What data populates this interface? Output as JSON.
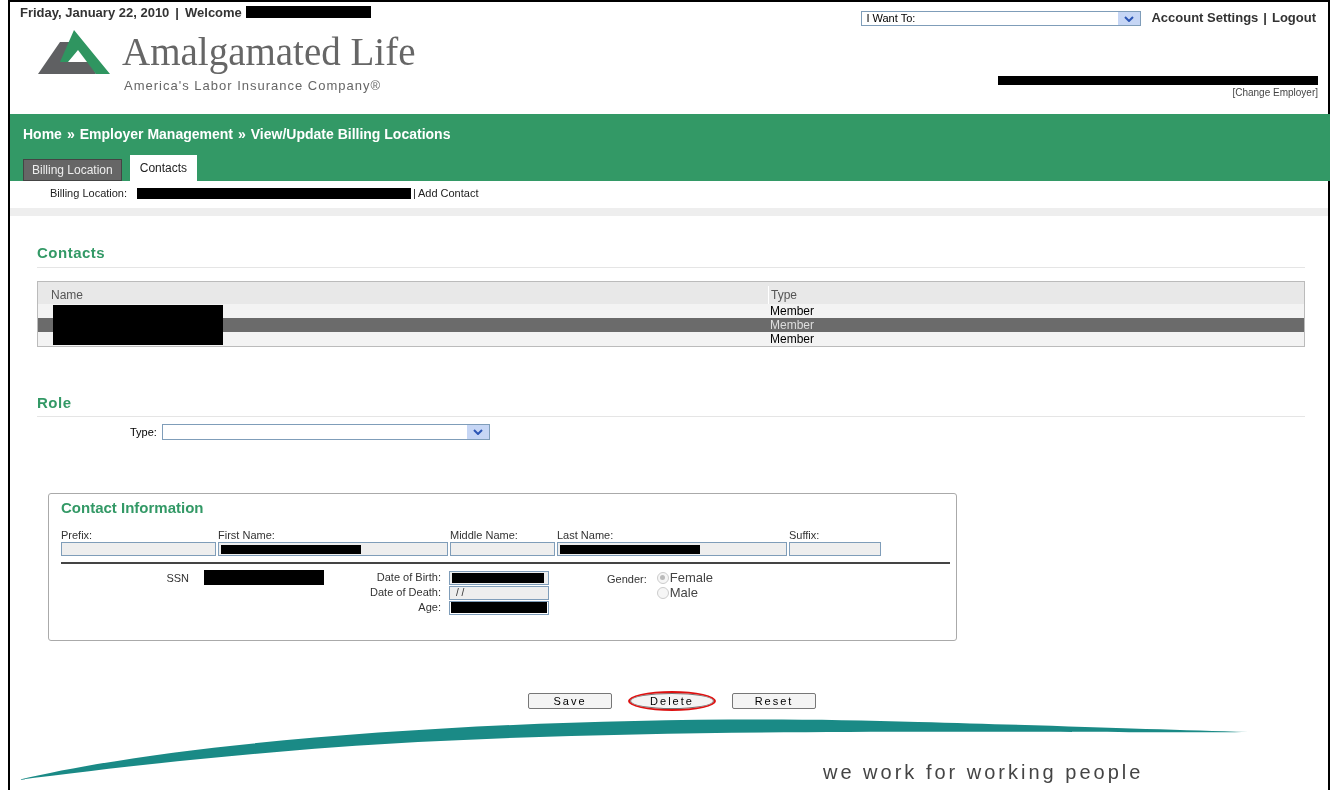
{
  "top_bar": {
    "date": "Friday, January 22, 2010",
    "separator": "|",
    "welcome": "Welcome",
    "links_separator": "|",
    "want_to": {
      "placeholder": "I Want To:"
    },
    "links": [
      "Account Settings",
      "Logout"
    ]
  },
  "logo": {
    "name": "Amalgamated Life",
    "tagline": "America's Labor Insurance Company®"
  },
  "change_employer": "[Change Employer]",
  "breadcrumb": [
    "Home",
    "Employer Management",
    "View/Update Billing Locations"
  ],
  "breadcrumb_separators": [
    "»",
    "»"
  ],
  "tabs": [
    {
      "label": "Billing Location",
      "selected": false
    },
    {
      "label": "Contacts",
      "selected": true
    }
  ],
  "billing_location": {
    "label": "Billing Location:",
    "separator": "|",
    "link": "Add Contact"
  },
  "contacts": {
    "heading": "Contacts",
    "columns": [
      "Name",
      "Type"
    ],
    "rows": [
      {
        "type": "Member",
        "selected": false
      },
      {
        "type": "Member",
        "selected": true
      },
      {
        "type": "Member",
        "selected": false
      }
    ]
  },
  "role": {
    "heading": "Role",
    "type_label": "Type:"
  },
  "contact_information": {
    "heading": "Contact Information",
    "name_fields": [
      {
        "label": "Prefix:",
        "redacted": false
      },
      {
        "label": "First Name:",
        "redacted": true
      },
      {
        "label": "Middle Name:",
        "redacted": false
      },
      {
        "label": "Last Name:",
        "redacted": true
      },
      {
        "label": "Suffix:",
        "redacted": false
      }
    ],
    "ssn_label": "SSN",
    "dob_label": "Date of Birth:",
    "dod_label": "Date of Death:",
    "dod_value": "/ /",
    "age_label": "Age:",
    "gender_label": "Gender:",
    "gender_options": [
      {
        "label": "Female",
        "selected": true
      },
      {
        "label": "Male",
        "selected": false
      }
    ]
  },
  "buttons": [
    {
      "label": "Save",
      "highlighted": false
    },
    {
      "label": "Delete",
      "highlighted": true
    },
    {
      "label": "Reset",
      "highlighted": false
    }
  ],
  "footer_slogan": "we work for working people"
}
